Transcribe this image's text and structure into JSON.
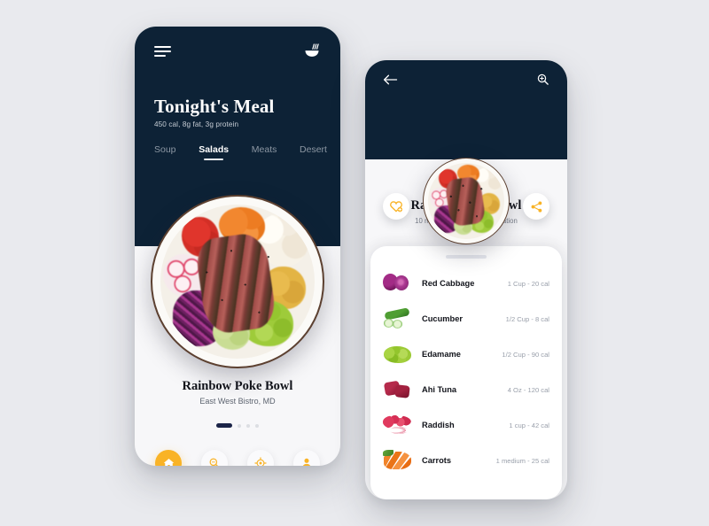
{
  "app": {
    "background_color": "#e9eaee",
    "navy": "#0d2236",
    "accent": "#f9b326",
    "card_bg": "#ffffff"
  },
  "phone1": {
    "menu_icon": "hamburger-icon",
    "brand_icon": "noodle-bowl-icon",
    "title": "Tonight's Meal",
    "nutrition": "450 cal, 8g fat, 3g protein",
    "tabs": [
      {
        "label": "Soup",
        "active": false
      },
      {
        "label": "Salads",
        "active": true
      },
      {
        "label": "Meats",
        "active": false
      },
      {
        "label": "Desert",
        "active": false
      }
    ],
    "hero_image_alt": "rainbow-poke-bowl-photo",
    "dish_name": "Rainbow Poke Bowl",
    "restaurant": "East West Bistro, MD",
    "carousel": {
      "total": 4,
      "active_index": 0
    },
    "bottom_nav": [
      {
        "icon": "home-icon",
        "active": true
      },
      {
        "icon": "search-icon",
        "active": false
      },
      {
        "icon": "location-target-icon",
        "active": false
      },
      {
        "icon": "profile-icon",
        "active": false
      }
    ]
  },
  "phone2": {
    "back_icon": "arrow-left-icon",
    "zoom_icon": "search-zoom-in-icon",
    "favorite_icon": "heart-plus-icon",
    "share_icon": "share-nodes-icon",
    "hero_image_alt": "rainbow-poke-bowl-photo",
    "dish_name": "Rainbow Poke Bowl",
    "distance": "10 min drive from current location",
    "ingredients": [
      {
        "thumb": "red-cabbage-thumb",
        "name": "Red Cabbage",
        "amount": "1 Cup - 20 cal"
      },
      {
        "thumb": "cucumber-thumb",
        "name": "Cucumber",
        "amount": "1/2 Cup - 8 cal"
      },
      {
        "thumb": "edamame-thumb",
        "name": "Edamame",
        "amount": "1/2 Cup - 90 cal"
      },
      {
        "thumb": "ahi-tuna-thumb",
        "name": "Ahi Tuna",
        "amount": "4 Oz - 120 cal"
      },
      {
        "thumb": "raddish-thumb",
        "name": "Raddish",
        "amount": "1 cup - 42 cal"
      },
      {
        "thumb": "carrots-thumb",
        "name": "Carrots",
        "amount": "1 medium - 25 cal"
      }
    ]
  }
}
